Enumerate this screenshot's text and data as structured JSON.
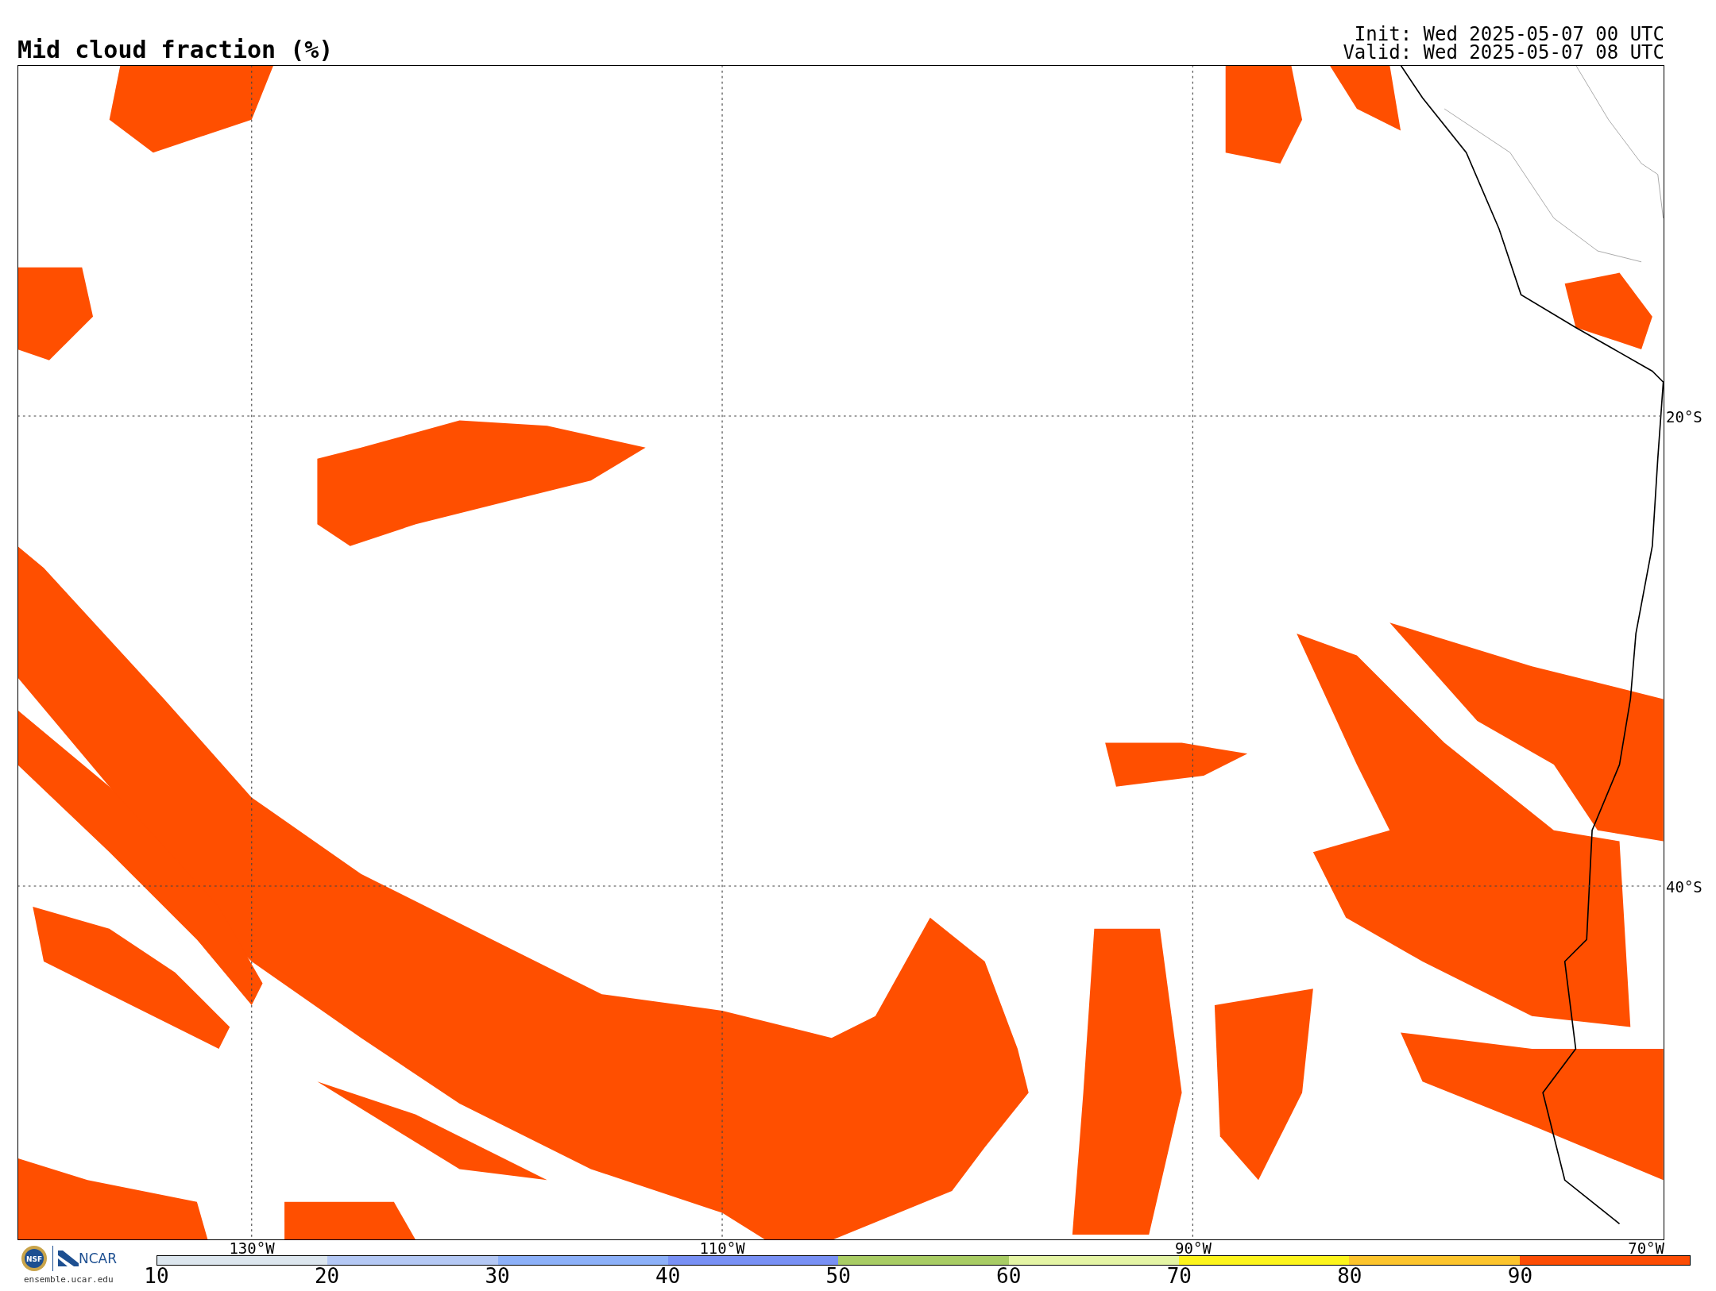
{
  "title": "Mid cloud fraction (%)",
  "init": "Init: Wed 2025-05-07 00 UTC",
  "valid": "Valid: Wed 2025-05-07 08 UTC",
  "map": {
    "lat_labels": [
      "20°S",
      "40°S"
    ],
    "lon_labels": [
      "130°W",
      "110°W",
      "90°W",
      "70°W"
    ]
  },
  "colorbar": {
    "segments": [
      {
        "color": "#dce6ee"
      },
      {
        "color": "#b4c8f4"
      },
      {
        "color": "#8cb0f8"
      },
      {
        "color": "#7890f4"
      },
      {
        "color": "#a8cc64"
      },
      {
        "color": "#e4f4a4"
      },
      {
        "color": "#fcf41c"
      },
      {
        "color": "#fcc42c"
      },
      {
        "color": "#fc4c04"
      }
    ],
    "tick_labels": [
      "10",
      "20",
      "30",
      "40",
      "50",
      "60",
      "70",
      "80",
      "90"
    ]
  },
  "logos": {
    "seal": "NSF",
    "ncar": "NCAR",
    "url": "ensemble.ucar.edu"
  }
}
